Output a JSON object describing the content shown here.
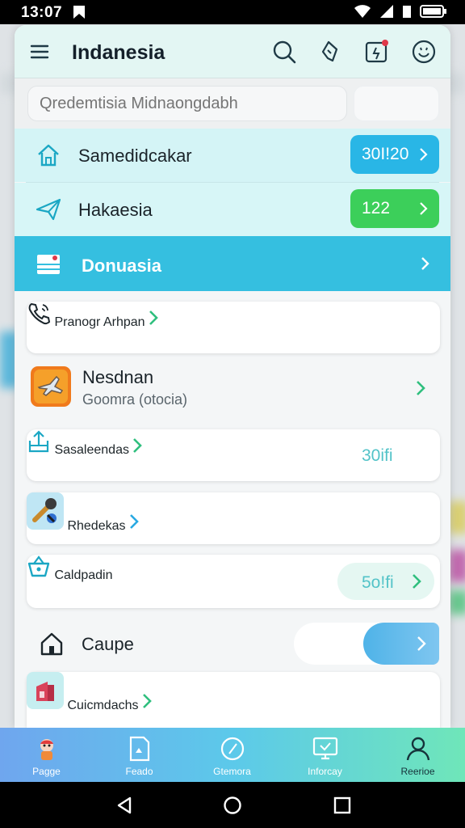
{
  "status_bar": {
    "time": "13:07"
  },
  "header": {
    "title": "Indanesia"
  },
  "search": {
    "placeholder": "Qredemtisia Midnaongdabh"
  },
  "menu": {
    "row1": {
      "label": "Samedidcakar",
      "badge": "30I!20"
    },
    "row2": {
      "label": "Hakaesia",
      "badge": "122"
    },
    "row3": {
      "label": "Donuasia"
    },
    "row4": {
      "label": "Pranogr Arhpan"
    },
    "row5": {
      "label": "Nesdnan",
      "sublabel": "Goomra (otocia)"
    },
    "row6": {
      "label": "Sasaleendas",
      "count": "30ifi"
    },
    "row7": {
      "label": "Rhedekas"
    },
    "row8": {
      "label": "Caldpadin",
      "count": "5o!fi"
    },
    "row9": {
      "label": "Caupe",
      "toggle_on": true
    },
    "row10": {
      "label": "Cuicmdachs"
    }
  },
  "bottom_nav": [
    {
      "label": "Pagge",
      "icon": "mascot-icon"
    },
    {
      "label": "Feado",
      "icon": "document-icon"
    },
    {
      "label": "Gtemora",
      "icon": "compass-icon"
    },
    {
      "label": "Inforcay",
      "icon": "monitor-icon"
    },
    {
      "label": "Reerioe",
      "icon": "person-icon"
    }
  ],
  "colors": {
    "accent_blue": "#29b6e6",
    "accent_green": "#3ccf5a",
    "highlight_row": "#35bfe0",
    "teal_icon": "#1ba7c4"
  }
}
